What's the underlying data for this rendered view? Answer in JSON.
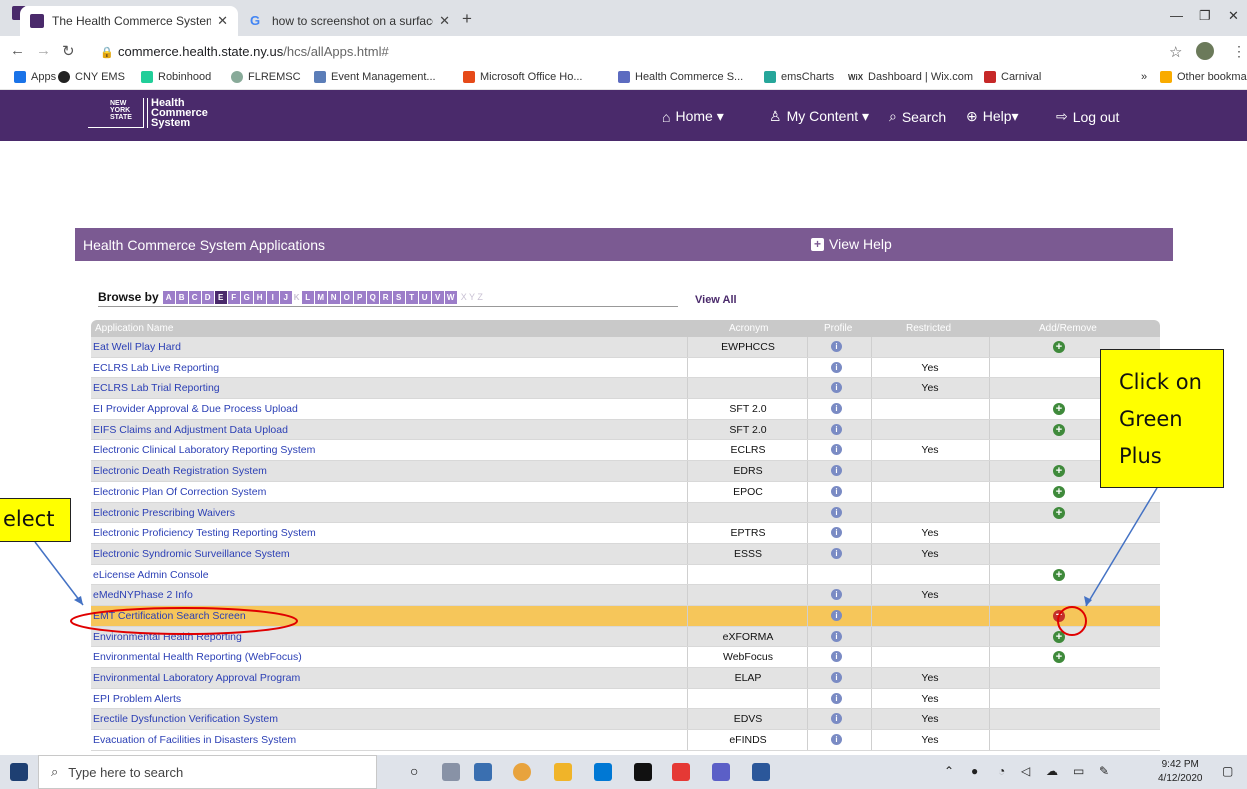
{
  "browser": {
    "tabs": [
      {
        "title": "The Health Commerce System",
        "active": true
      },
      {
        "title": "how to screenshot on a surface p",
        "active": false
      }
    ],
    "new_tab": "+",
    "url_host": "commerce.health.state.ny.us",
    "url_path": "/hcs/allApps.html#",
    "bookmarks": [
      "Apps",
      "CNY EMS",
      "Robinhood",
      "FLREMSC",
      "Event Management...",
      "Microsoft Office Ho...",
      "Health Commerce S...",
      "emsCharts",
      "Dashboard | Wix.com",
      "Carnival"
    ],
    "overflow": "»",
    "other_bookmarks": "Other bookmarks"
  },
  "header": {
    "logo_state": "NEW YORK STATE",
    "logo_lines": [
      "Health",
      "Commerce",
      "System"
    ],
    "nav": [
      "Home ▾",
      "My Content ▾",
      "Search",
      "Help▾",
      "Log out"
    ]
  },
  "panel": {
    "title": "Health Commerce System Applications",
    "view_help": "View Help",
    "browse_label": "Browse by",
    "letters": [
      "A",
      "B",
      "C",
      "D",
      "E",
      "F",
      "G",
      "H",
      "I",
      "J",
      "K",
      "L",
      "M",
      "N",
      "O",
      "P",
      "Q",
      "R",
      "S",
      "T",
      "U",
      "V",
      "W"
    ],
    "current_letter": "E",
    "disabled_letters": [
      "K"
    ],
    "letters_tail": "X Y Z",
    "view_all": "View All",
    "columns": [
      "Application Name",
      "Acronym",
      "Profile",
      "Restricted",
      "Add/Remove"
    ]
  },
  "rows": [
    {
      "name": "Eat Well Play Hard",
      "acronym": "EWPHCCS",
      "profile": true,
      "restricted": "",
      "action": "add"
    },
    {
      "name": "ECLRS Lab Live Reporting",
      "acronym": "",
      "profile": true,
      "restricted": "Yes",
      "action": ""
    },
    {
      "name": "ECLRS Lab Trial Reporting",
      "acronym": "",
      "profile": true,
      "restricted": "Yes",
      "action": ""
    },
    {
      "name": "EI Provider Approval & Due Process Upload",
      "acronym": "SFT 2.0",
      "profile": true,
      "restricted": "",
      "action": "add"
    },
    {
      "name": "EIFS Claims and Adjustment Data Upload",
      "acronym": "SFT 2.0",
      "profile": true,
      "restricted": "",
      "action": "add"
    },
    {
      "name": "Electronic Clinical Laboratory Reporting System",
      "acronym": "ECLRS",
      "profile": true,
      "restricted": "Yes",
      "action": ""
    },
    {
      "name": "Electronic Death Registration System",
      "acronym": "EDRS",
      "profile": true,
      "restricted": "",
      "action": "add"
    },
    {
      "name": "Electronic Plan Of Correction System",
      "acronym": "EPOC",
      "profile": true,
      "restricted": "",
      "action": "add"
    },
    {
      "name": "Electronic Prescribing Waivers",
      "acronym": "",
      "profile": true,
      "restricted": "",
      "action": "add"
    },
    {
      "name": "Electronic Proficiency Testing Reporting System",
      "acronym": "EPTRS",
      "profile": true,
      "restricted": "Yes",
      "action": ""
    },
    {
      "name": "Electronic Syndromic Surveillance System",
      "acronym": "ESSS",
      "profile": true,
      "restricted": "Yes",
      "action": ""
    },
    {
      "name": "eLicense Admin Console",
      "acronym": "",
      "profile": false,
      "restricted": "",
      "action": "add"
    },
    {
      "name": "eMedNYPhase 2 Info",
      "acronym": "",
      "profile": true,
      "restricted": "Yes",
      "action": ""
    },
    {
      "name": "EMT Certification Search Screen",
      "acronym": "",
      "profile": true,
      "restricted": "",
      "action": "remove",
      "selected": true
    },
    {
      "name": "Environmental Health Reporting",
      "acronym": "eXFORMA",
      "profile": true,
      "restricted": "",
      "action": "add"
    },
    {
      "name": "Environmental Health Reporting (WebFocus)",
      "acronym": "WebFocus",
      "profile": true,
      "restricted": "",
      "action": "add"
    },
    {
      "name": "Environmental Laboratory Approval Program",
      "acronym": "ELAP",
      "profile": true,
      "restricted": "Yes",
      "action": ""
    },
    {
      "name": "EPI Problem Alerts",
      "acronym": "",
      "profile": true,
      "restricted": "Yes",
      "action": ""
    },
    {
      "name": "Erectile Dysfunction Verification System",
      "acronym": "EDVS",
      "profile": true,
      "restricted": "Yes",
      "action": ""
    },
    {
      "name": "Evacuation of Facilities in Disasters System",
      "acronym": "eFINDS",
      "profile": true,
      "restricted": "Yes",
      "action": ""
    }
  ],
  "annotations": {
    "plus_callout_lines": [
      "Click on",
      "Green",
      "Plus"
    ],
    "select_callout": "elect"
  },
  "taskbar": {
    "search_placeholder": "Type here to search",
    "time": "9:42 PM",
    "date": "4/12/2020"
  },
  "colors": {
    "header_purple": "#4a2a6b",
    "panel_purple": "#7b5a92",
    "letter_purple": "#9c7dc9",
    "link_blue": "#2b3fb5",
    "selected_row": "#f6c65a",
    "add_green": "#3f8a3b",
    "remove_red": "#c3302b",
    "callout_yellow": "#ffff00"
  }
}
